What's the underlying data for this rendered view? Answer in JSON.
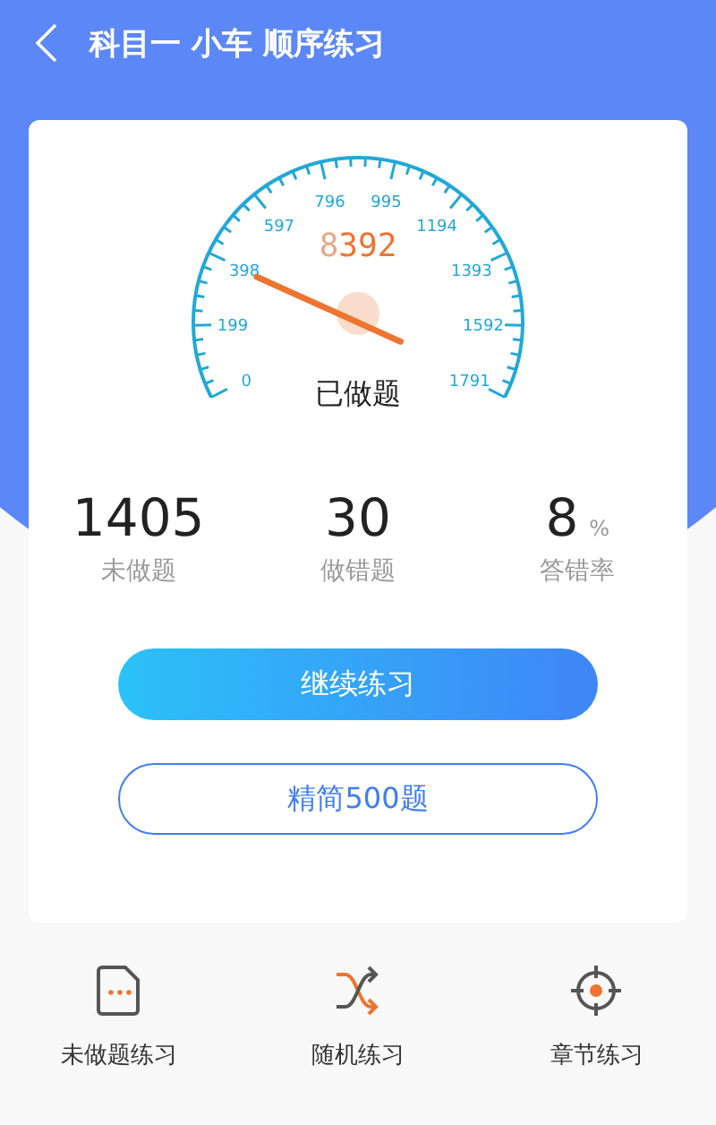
{
  "header": {
    "title": "科目一 小车 顺序练习"
  },
  "gauge": {
    "ticks": [
      "796",
      "995",
      "597",
      "1194",
      "398",
      "1393",
      "199",
      "1592",
      "0",
      "1791"
    ],
    "display_blank": "8",
    "display": "392",
    "label": "已做题"
  },
  "stats": [
    {
      "value": "1405",
      "label": "未做题"
    },
    {
      "value": "30",
      "label": "做错题"
    },
    {
      "value": "8",
      "unit": "%",
      "label": "答错率"
    }
  ],
  "buttons": [
    {
      "label": "继续练习",
      "kind": "primary"
    },
    {
      "label": "精简500题",
      "kind": "outline"
    }
  ],
  "shortcuts": [
    {
      "label": "未做题练习",
      "kind": "file"
    },
    {
      "label": "随机练习",
      "kind": "shuffle"
    },
    {
      "label": "章节练习",
      "kind": "target"
    }
  ]
}
